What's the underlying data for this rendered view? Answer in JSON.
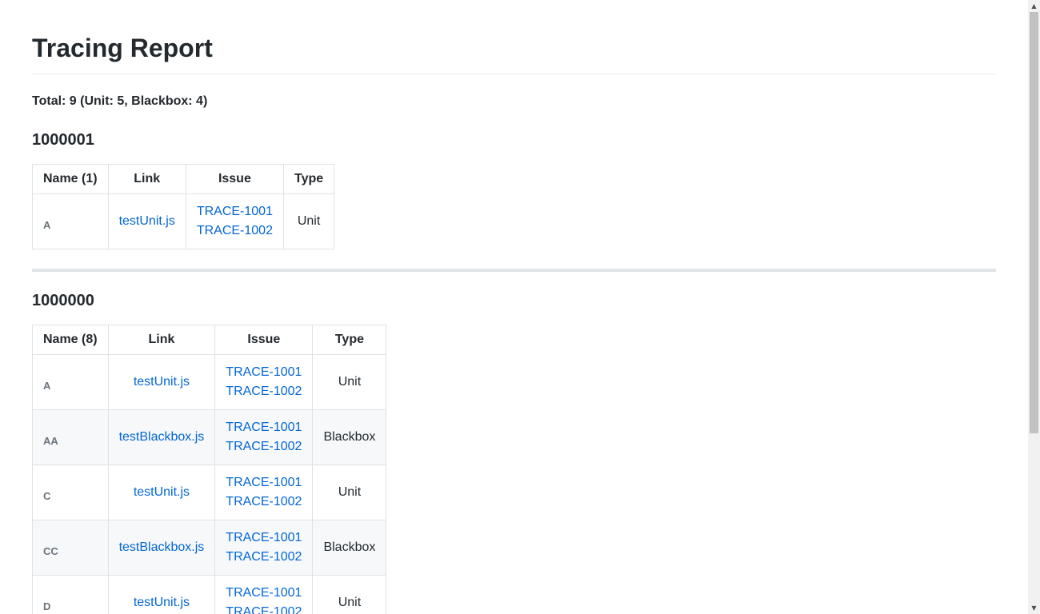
{
  "title": "Tracing Report",
  "total": "Total: 9 (Unit: 5, Blackbox: 4)",
  "sections": [
    {
      "id": "1000001",
      "headers": {
        "name": "Name (1)",
        "link": "Link",
        "issue": "Issue",
        "type": "Type"
      },
      "rows": [
        {
          "name": "A",
          "link": "testUnit.js",
          "issues": [
            "TRACE-1001",
            "TRACE-1002"
          ],
          "type": "Unit"
        }
      ]
    },
    {
      "id": "1000000",
      "headers": {
        "name": "Name (8)",
        "link": "Link",
        "issue": "Issue",
        "type": "Type"
      },
      "rows": [
        {
          "name": "A",
          "link": "testUnit.js",
          "issues": [
            "TRACE-1001",
            "TRACE-1002"
          ],
          "type": "Unit"
        },
        {
          "name": "AA",
          "link": "testBlackbox.js",
          "issues": [
            "TRACE-1001",
            "TRACE-1002"
          ],
          "type": "Blackbox"
        },
        {
          "name": "C",
          "link": "testUnit.js",
          "issues": [
            "TRACE-1001",
            "TRACE-1002"
          ],
          "type": "Unit"
        },
        {
          "name": "CC",
          "link": "testBlackbox.js",
          "issues": [
            "TRACE-1001",
            "TRACE-1002"
          ],
          "type": "Blackbox"
        },
        {
          "name": "D",
          "link": "testUnit.js",
          "issues": [
            "TRACE-1001",
            "TRACE-1002"
          ],
          "type": "Unit"
        }
      ]
    }
  ],
  "scrollbar": {
    "up_icon": "▲",
    "down_icon": "▼"
  }
}
